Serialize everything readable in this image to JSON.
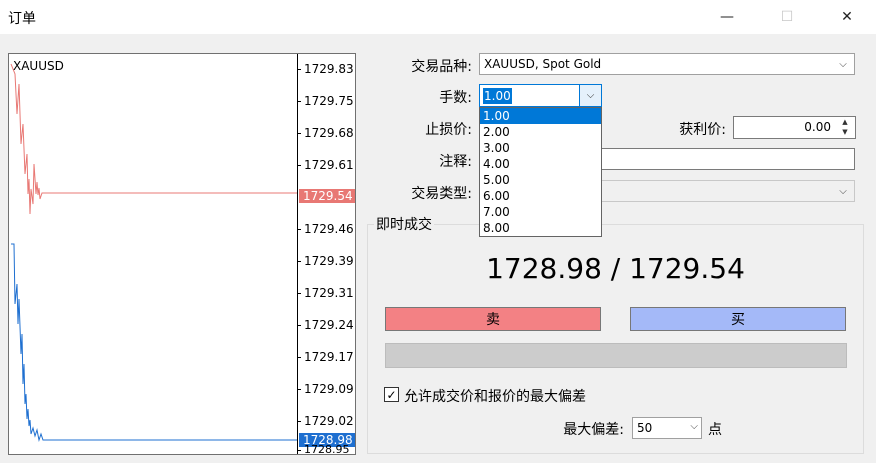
{
  "window": {
    "title": "订单",
    "min_icon": "—",
    "max_icon": "☐",
    "close_icon": "✕"
  },
  "chart": {
    "symbol": "XAUUSD",
    "ticks": [
      "1729.83",
      "1729.75",
      "1729.68",
      "1729.61",
      "1729.46",
      "1729.39",
      "1729.31",
      "1729.24",
      "1729.17",
      "1729.09",
      "1729.02",
      "1728.95"
    ],
    "ask_tag": "1729.54",
    "bid_tag": "1728.98",
    "ask_color": "#e87874",
    "bid_color": "#1e6fd0"
  },
  "form": {
    "symbol_label": "交易品种:",
    "symbol_value": "XAUUSD, Spot Gold",
    "volume_label": "手数:",
    "volume_value": "1.00",
    "volume_options": [
      "1.00",
      "2.00",
      "3.00",
      "4.00",
      "5.00",
      "6.00",
      "7.00",
      "8.00"
    ],
    "sl_label": "止损价:",
    "tp_label": "获利价:",
    "tp_value": "0.00",
    "comment_label": "注释:",
    "comment_value": "",
    "type_label": "交易类型:",
    "type_value": ""
  },
  "instant": {
    "group_title": "即时成交",
    "quote": "1728.98 / 1729.54",
    "sell_label": "卖",
    "buy_label": "买",
    "sell_color": "#f38184",
    "buy_color": "#a4b9f8",
    "allow_deviation_checked": true,
    "allow_deviation_label": "允许成交价和报价的最大偏差",
    "max_deviation_label": "最大偏差:",
    "max_deviation_value": "50",
    "points_label": "点"
  }
}
